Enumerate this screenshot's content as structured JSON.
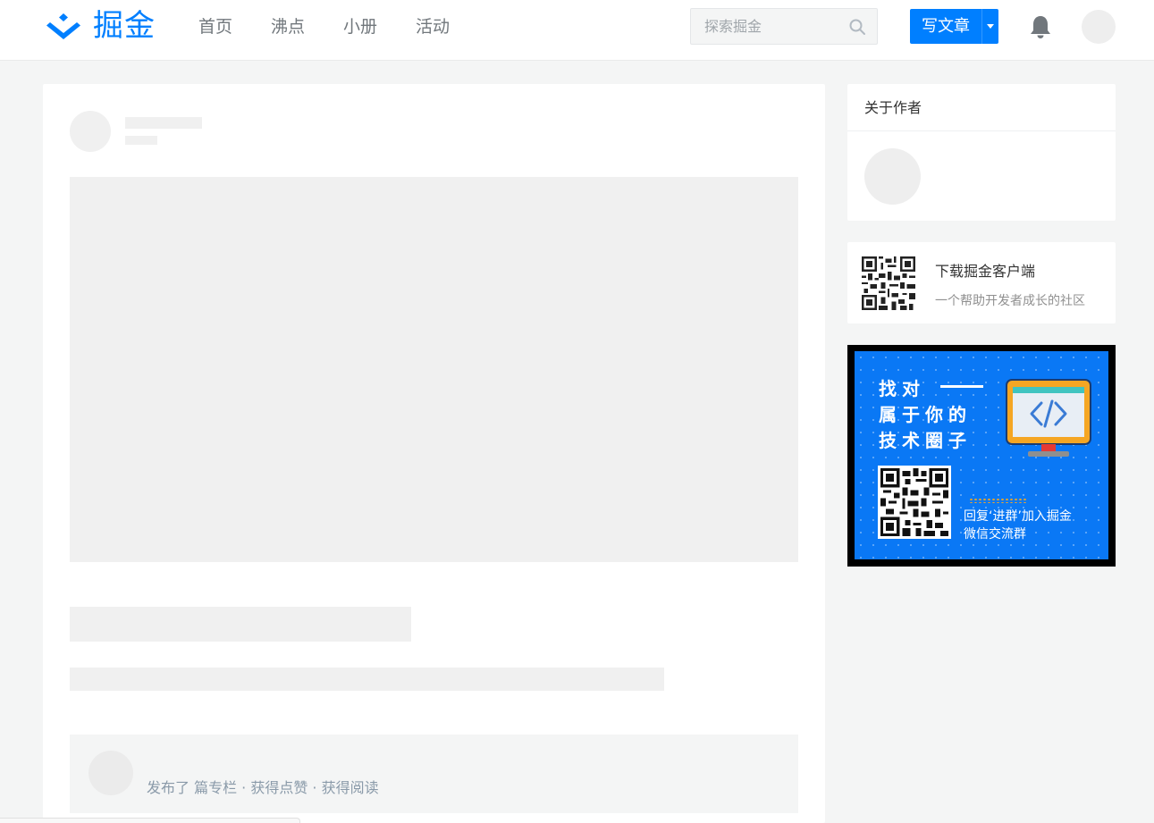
{
  "header": {
    "logo_text": "掘金",
    "nav": [
      "首页",
      "沸点",
      "小册",
      "活动"
    ],
    "search_placeholder": "探索掘金",
    "write_label": "写文章"
  },
  "article": {
    "author_stats": "发布了 篇专栏 · 获得点赞 · 获得阅读"
  },
  "sidebar": {
    "author_title": "关于作者",
    "download": {
      "title": "下载掘金客户端",
      "subtitle": "一个帮助开发者成长的社区"
    },
    "banner": {
      "line1": "找对",
      "line2": "属于你的",
      "line3": "技术圈子",
      "reply_line1": "回复‘进群’加入掘金",
      "reply_line2": "微信交流群"
    }
  },
  "colors": {
    "brand": "#007fff",
    "page_bg": "#f4f5f5",
    "banner_bg": "#0a78f5"
  }
}
